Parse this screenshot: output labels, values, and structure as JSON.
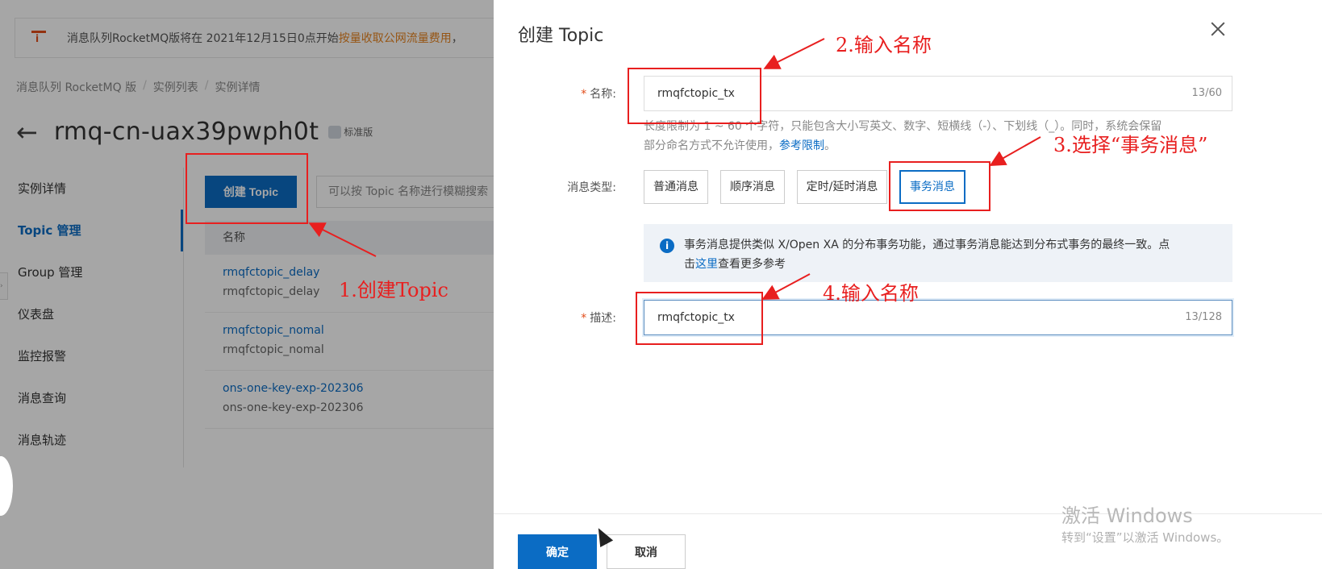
{
  "notice": {
    "text_prefix": "消息队列RocketMQ版将在 2021年12月15日0点开始",
    "text_highlight": "按量收取公网流量费用",
    "text_suffix": "，"
  },
  "breadcrumb": [
    "消息队列 RocketMQ 版",
    "/",
    "实例列表",
    "/",
    "实例详情"
  ],
  "page": {
    "back_icon": "←",
    "title": "rmq-cn-uax39pwph0t",
    "edition": "标准版"
  },
  "sidebar": {
    "items": [
      "实例详情",
      "Topic 管理",
      "Group 管理",
      "仪表盘",
      "监控报警",
      "消息查询",
      "消息轨迹"
    ],
    "active": "Topic 管理"
  },
  "topic_list": {
    "create_button": "创建 Topic",
    "search_placeholder": "可以按 Topic 名称进行模糊搜索",
    "column_name": "名称",
    "rows": [
      {
        "name": "rmqfctopic_delay",
        "desc": "rmqfctopic_delay"
      },
      {
        "name": "rmqfctopic_nomal",
        "desc": "rmqfctopic_nomal"
      },
      {
        "name": "ons-one-key-exp-202306",
        "desc": "ons-one-key-exp-202306"
      }
    ]
  },
  "drawer": {
    "title": "创建 Topic",
    "name_label": "名称:",
    "name_value": "rmqfctopic_tx",
    "name_count": "13/60",
    "hint_line1": "长度限制为 1 ~ 60 个字符，只能包含大小写英文、数字、短横线（-）、下划线（_）。同时，系统会保留",
    "hint_line2": "部分命名方式不允许使用，",
    "hint_link": "参考限制",
    "hint_end": "。",
    "type_label": "消息类型:",
    "types": [
      "普通消息",
      "顺序消息",
      "定时/延时消息",
      "事务消息"
    ],
    "selected_type": "事务消息",
    "info_line1": "事务消息提供类似 X/Open XA 的分布事务功能，通过事务消息能达到分布式事务的最终一致。点",
    "info_line2_prefix": "击",
    "info_link": "这里",
    "info_line2_suffix": "查看更多参考",
    "desc_label": "描述:",
    "desc_value": "rmqfctopic_tx",
    "desc_count": "13/128",
    "ok_button": "确定",
    "cancel_button": "取消"
  },
  "annotations": {
    "step1": "1.创建Topic",
    "step2": "2.输入名称",
    "step3": "3.选择“事务消息”",
    "step4": "4.输入名称",
    "color": "#e81f1f"
  },
  "watermark": {
    "line1": "激活 Windows",
    "line2": "转到“设置”以激活 Windows。"
  },
  "colors": {
    "primary": "#0b6cc4",
    "warning": "#e6831f"
  }
}
